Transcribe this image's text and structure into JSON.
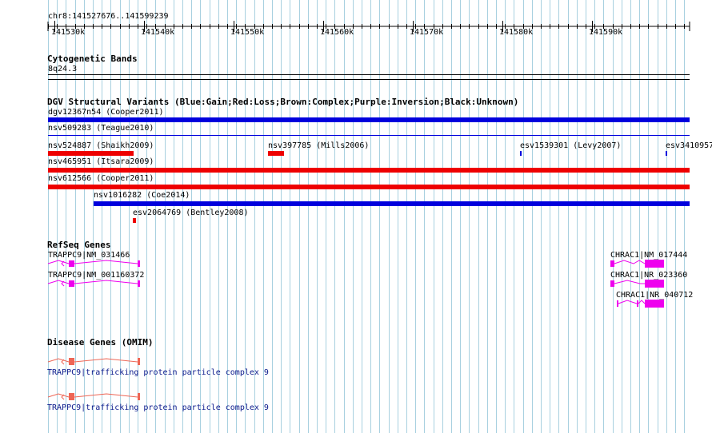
{
  "region": "chr8:141527676..141599239",
  "ruler": {
    "ticks": [
      "141530k",
      "141540k",
      "141550k",
      "141560k",
      "141570k",
      "141580k",
      "141590k"
    ]
  },
  "cytoband": {
    "title": "Cytogenetic Bands",
    "band": "8q24.3"
  },
  "dgv": {
    "title": "DGV Structural Variants (Blue:Gain;Red:Loss;Brown:Complex;Purple:Inversion;Black:Unknown)",
    "variants": [
      {
        "label": "dgv12367n54 (Cooper2011)",
        "type": "Gain"
      },
      {
        "label": "nsv509283 (Teague2010)",
        "type": "Gain"
      },
      {
        "label": "nsv524887 (Shaikh2009)",
        "type": "Loss"
      },
      {
        "label": "nsv397785 (Mills2006)",
        "type": "Loss"
      },
      {
        "label": "esv1539301 (Levy2007)",
        "type": "Gain"
      },
      {
        "label": "esv3410957",
        "type": "Gain"
      },
      {
        "label": "nsv465951 (Itsara2009)",
        "type": "Loss"
      },
      {
        "label": "nsv612566 (Cooper2011)",
        "type": "Loss"
      },
      {
        "label": "nsv1016282 (Coe2014)",
        "type": "Gain"
      },
      {
        "label": "esv2064769 (Bentley2008)",
        "type": "Loss"
      }
    ]
  },
  "refseq": {
    "title": "RefSeq Genes",
    "genes": [
      {
        "label": "TRAPPC9|NM_031466"
      },
      {
        "label": "TRAPPC9|NM_001160372"
      },
      {
        "label": "CHRAC1|NM_017444"
      },
      {
        "label": "CHRAC1|NR_023360"
      },
      {
        "label": "CHRAC1|NR_040712"
      }
    ]
  },
  "omim": {
    "title": "Disease Genes (OMIM)",
    "genes": [
      {
        "label": "TRAPPC9|trafficking protein particle complex 9"
      },
      {
        "label": "TRAPPC9|trafficking protein particle complex 9"
      }
    ]
  },
  "colors": {
    "gain": "#0000dd",
    "loss": "#ee0000",
    "refseq": "#ee00ee",
    "omim": "#ee6655",
    "gridline": "#a8d0e0",
    "text_link": "#0b1a8c"
  }
}
